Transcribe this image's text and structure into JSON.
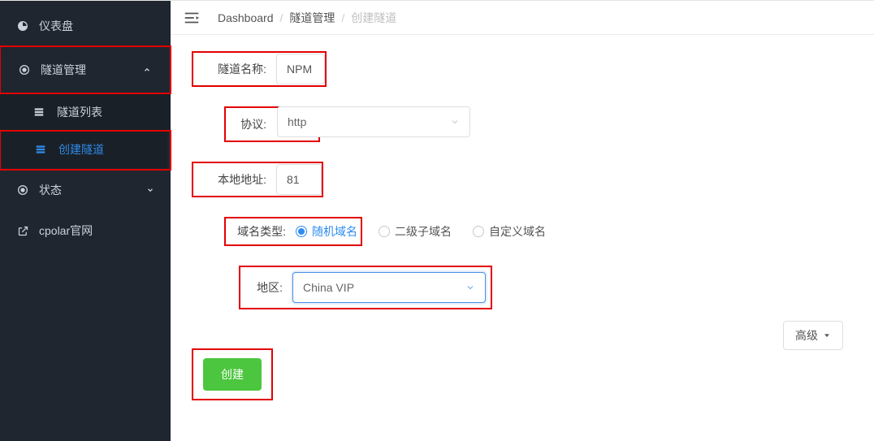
{
  "sidebar": {
    "dashboard": "仪表盘",
    "tunnel_mgmt": "隧道管理",
    "tunnel_list": "隧道列表",
    "tunnel_create": "创建隧道",
    "status": "状态",
    "cpolar_site": "cpolar官网"
  },
  "breadcrumb": {
    "a": "Dashboard",
    "b": "隧道管理",
    "c": "创建隧道"
  },
  "form": {
    "name_label": "隧道名称:",
    "name_value": "NPM",
    "proto_label": "协议:",
    "proto_value": "http",
    "addr_label": "本地地址:",
    "addr_value": "81",
    "domain_type_label": "域名类型:",
    "domain_type_opts": {
      "random": "随机域名",
      "sub": "二级子域名",
      "custom": "自定义域名"
    },
    "region_label": "地区:",
    "region_value": "China VIP",
    "advanced": "高级",
    "submit": "创建"
  }
}
